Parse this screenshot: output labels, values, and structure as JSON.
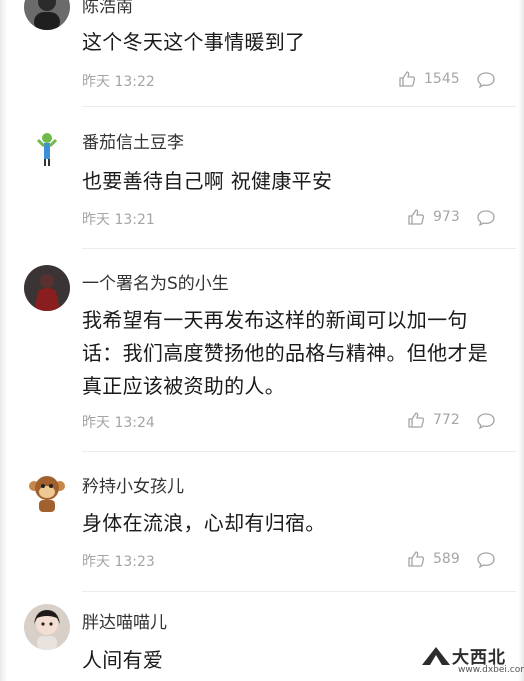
{
  "comments": [
    {
      "username": "陈浩南",
      "content": "这个冬天这个事情暖到了",
      "time": "昨天 13:22",
      "likes": "1545",
      "avatar": "man-dark-portrait-avatar"
    },
    {
      "username": "番茄信土豆李",
      "content": "也要善待自己啊 祝健康平安",
      "time": "昨天 13:21",
      "likes": "973",
      "avatar": "cartoon-figure-avatar"
    },
    {
      "username": "一个署名为S的小生",
      "content": "我希望有一天再发布这样的新闻可以加一句话：我们高度赞扬他的品格与精神。但他才是真正应该被资助的人。",
      "time": "昨天 13:24",
      "likes": "772",
      "avatar": "dark-red-figure-avatar"
    },
    {
      "username": "矜持小女孩儿",
      "content": "身体在流浪，心却有归宿。",
      "time": "昨天 13:23",
      "likes": "589",
      "avatar": "monkey-cartoon-avatar"
    },
    {
      "username": "胖达喵喵儿",
      "content": "人间有爱",
      "time": "",
      "likes": "",
      "avatar": "girl-photo-avatar"
    }
  ],
  "watermark": {
    "text": "大西北",
    "url": "www.dxbei.com"
  },
  "colors": {
    "meta_gray": "#a5a5a5",
    "text": "#1a1a1a",
    "divider": "#ececec"
  }
}
